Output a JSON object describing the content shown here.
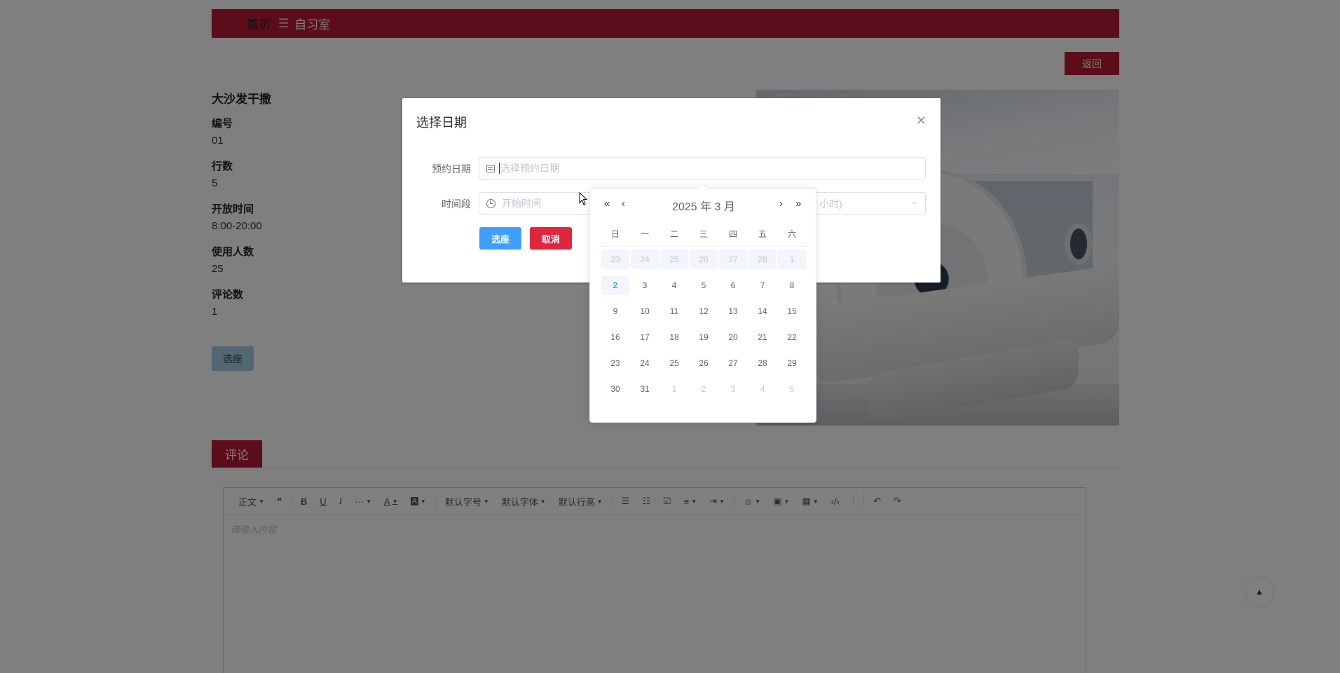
{
  "breadcrumb": {
    "home": "首页",
    "separator": "☰",
    "current": "自习室"
  },
  "back_label": "返回",
  "room": {
    "name": "大沙发干撒",
    "fields": [
      {
        "label": "编号",
        "value": "01"
      },
      {
        "label": "行数",
        "value": "5"
      },
      {
        "label": "开放时间",
        "value": "8:00-20:00"
      },
      {
        "label": "使用人数",
        "value": "25"
      },
      {
        "label": "评论数",
        "value": "1"
      }
    ],
    "seat_button": "选座"
  },
  "comment_tab": "评论",
  "editor": {
    "toolbar": [
      "正文",
      "❝",
      "B",
      "U",
      "I",
      "···",
      "A",
      "A",
      "默认字号",
      "默认字体",
      "默认行高",
      "☰",
      "☷",
      "☑",
      "≡",
      "⇥",
      "☺",
      "▣",
      "▦",
      "‹/›",
      "⫶",
      "↶",
      "↷"
    ],
    "placeholder": "请输入内容"
  },
  "dialog": {
    "title": "选择日期",
    "date_label": "预约日期",
    "date_placeholder": "选择预约日期",
    "time_label": "时间段",
    "start_placeholder": "开始时间",
    "end_placeholder_fragment": "小时)",
    "ok_label": "选座",
    "cancel_label": "取消"
  },
  "picker": {
    "header": "2025 年  3 月",
    "weekdays": [
      "日",
      "一",
      "二",
      "三",
      "四",
      "五",
      "六"
    ],
    "weeks": [
      [
        [
          "23",
          "prev"
        ],
        [
          "24",
          "prev"
        ],
        [
          "25",
          "prev"
        ],
        [
          "26",
          "prev"
        ],
        [
          "27",
          "prev"
        ],
        [
          "28",
          "prev"
        ],
        [
          "1",
          "prev"
        ]
      ],
      [
        [
          "2",
          "today"
        ],
        [
          "3",
          ""
        ],
        [
          "4",
          ""
        ],
        [
          "5",
          ""
        ],
        [
          "6",
          ""
        ],
        [
          "7",
          ""
        ],
        [
          "8",
          ""
        ]
      ],
      [
        [
          "9",
          ""
        ],
        [
          "10",
          ""
        ],
        [
          "11",
          ""
        ],
        [
          "12",
          ""
        ],
        [
          "13",
          ""
        ],
        [
          "14",
          ""
        ],
        [
          "15",
          ""
        ]
      ],
      [
        [
          "16",
          ""
        ],
        [
          "17",
          ""
        ],
        [
          "18",
          ""
        ],
        [
          "19",
          ""
        ],
        [
          "20",
          ""
        ],
        [
          "21",
          ""
        ],
        [
          "22",
          ""
        ]
      ],
      [
        [
          "23",
          ""
        ],
        [
          "24",
          ""
        ],
        [
          "25",
          ""
        ],
        [
          "26",
          ""
        ],
        [
          "27",
          ""
        ],
        [
          "28",
          ""
        ],
        [
          "29",
          ""
        ]
      ],
      [
        [
          "30",
          ""
        ],
        [
          "31",
          ""
        ],
        [
          "1",
          "next"
        ],
        [
          "2",
          "next"
        ],
        [
          "3",
          "next"
        ],
        [
          "4",
          "next"
        ],
        [
          "5",
          "next"
        ]
      ]
    ]
  }
}
